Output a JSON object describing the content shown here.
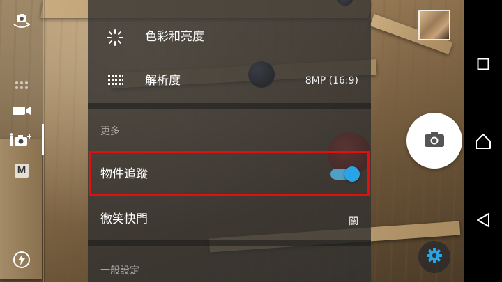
{
  "menu": {
    "items": [
      {
        "label": "色彩和亮度",
        "icon": "brightness-icon"
      },
      {
        "label": "解析度",
        "value": "8MP (16:9)",
        "icon": "resolution-grid-icon"
      }
    ],
    "section_more": "更多",
    "object_tracking": {
      "label": "物件追蹤",
      "enabled": true
    },
    "smile_shutter": {
      "label": "微笑快門",
      "value": "關"
    },
    "section_general": "一般設定"
  },
  "left_rail": {
    "icons": [
      "camera-switch-icon",
      "app-grid-icon",
      "video-mode-icon",
      "superior-auto-icon",
      "manual-mode-icon",
      "flash-auto-icon"
    ],
    "manual_label": "M"
  },
  "right_panel": {
    "icons": [
      "gallery-thumbnail",
      "shutter-camera-icon",
      "settings-gear-icon"
    ]
  },
  "navigation_bar": {
    "icons": [
      "recent-apps-icon",
      "home-icon",
      "back-icon"
    ]
  },
  "colors": {
    "accent": "#2aa4e8",
    "highlight": "#e01010",
    "menu_background": "#303030"
  }
}
